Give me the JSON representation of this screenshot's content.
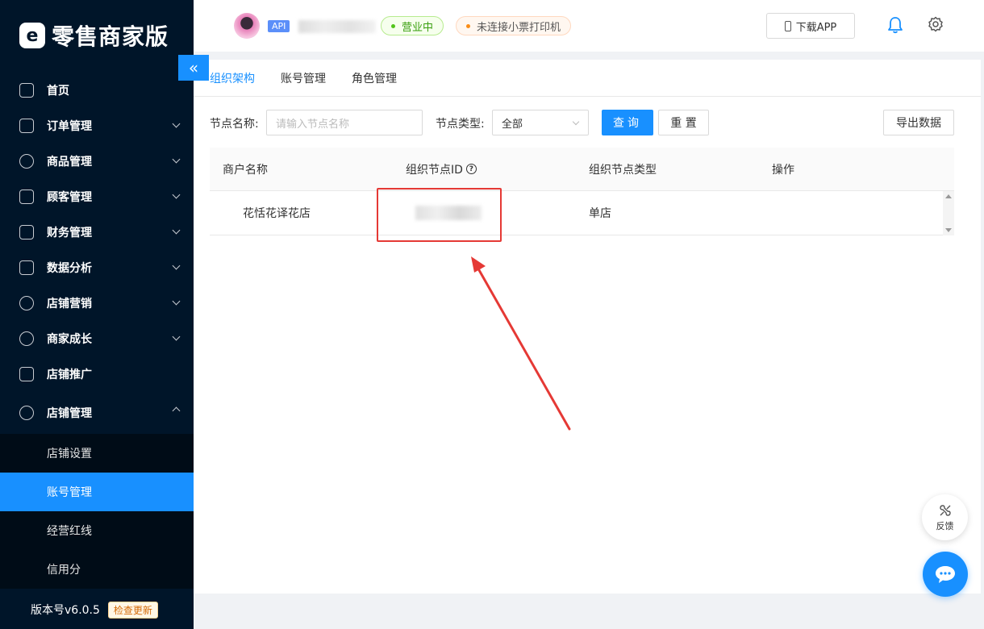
{
  "brand": {
    "logo_letter": "e",
    "title": "零售商家版"
  },
  "sidebar": {
    "items": [
      {
        "label": "首页"
      },
      {
        "label": "订单管理"
      },
      {
        "label": "商品管理"
      },
      {
        "label": "顾客管理"
      },
      {
        "label": "财务管理"
      },
      {
        "label": "数据分析"
      },
      {
        "label": "店铺营销"
      },
      {
        "label": "商家成长"
      },
      {
        "label": "店铺推广"
      },
      {
        "label": "店铺管理"
      }
    ],
    "subitems": [
      {
        "label": "店铺设置"
      },
      {
        "label": "账号管理"
      },
      {
        "label": "经营红线"
      },
      {
        "label": "信用分"
      }
    ],
    "version": "版本号v6.0.5",
    "update_label": "检查更新",
    "collapse_glyph": "«"
  },
  "header": {
    "api_tag": "API",
    "status_open": "营业中",
    "printer_status": "未连接小票打印机",
    "download_label": "下载APP"
  },
  "tabs": [
    {
      "label": "组织架构"
    },
    {
      "label": "账号管理"
    },
    {
      "label": "角色管理"
    }
  ],
  "filters": {
    "node_name_label": "节点名称:",
    "node_name_placeholder": "请输入节点名称",
    "node_type_label": "节点类型:",
    "node_type_value": "全部",
    "query_label": "查询",
    "reset_label": "重 置",
    "export_label": "导出数据"
  },
  "table": {
    "headers": [
      "商户名称",
      "组织节点ID",
      "组织节点类型",
      "操作"
    ],
    "rows": [
      {
        "shop": "花恬花译花店",
        "type": "单店"
      }
    ]
  },
  "floating": {
    "feedback_label": "反馈"
  },
  "colors": {
    "accent": "#1890ff",
    "sidebar_bg": "#001529",
    "highlight": "#e53935"
  }
}
